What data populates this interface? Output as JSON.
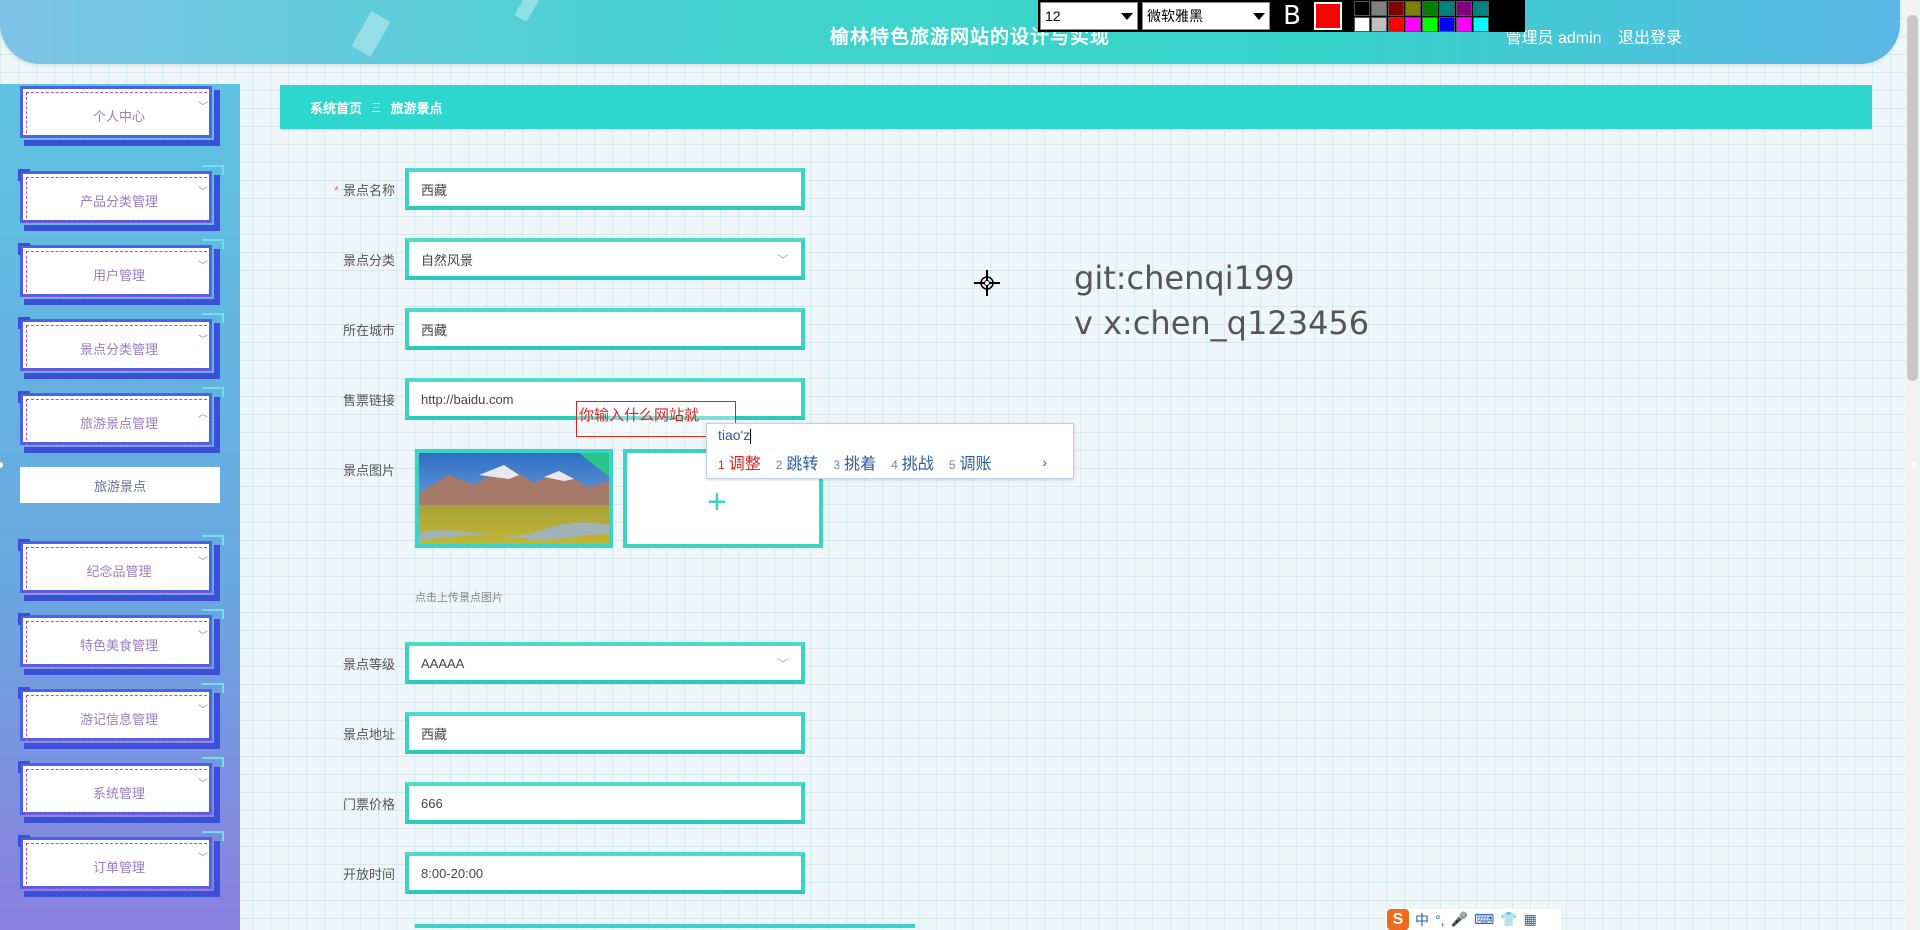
{
  "header": {
    "title": "榆林特色旅游网站的设计与实现",
    "user_label": "管理员 admin",
    "logout": "退出登录"
  },
  "editor_toolbar": {
    "font_size": "12",
    "font_family": "微软雅黑",
    "bold_label": "B",
    "current_color": "#ff0000",
    "palette": [
      "#000000",
      "#808080",
      "#800000",
      "#808000",
      "#008000",
      "#008080",
      "#800080",
      "#008080",
      "#ffffff",
      "#c0c0c0",
      "#ff0000",
      "#ff00ff",
      "#00ff00",
      "#0000ff",
      "#ff00ff",
      "#00ffff"
    ]
  },
  "sidebar": {
    "items": [
      {
        "label": "个人中心"
      },
      {
        "label": "产品分类管理"
      },
      {
        "label": "用户管理"
      },
      {
        "label": "景点分类管理"
      },
      {
        "label": "旅游景点管理"
      },
      {
        "label": "纪念品管理"
      },
      {
        "label": "特色美食管理"
      },
      {
        "label": "游记信息管理"
      },
      {
        "label": "系统管理"
      },
      {
        "label": "订单管理"
      }
    ],
    "active_sub": "旅游景点"
  },
  "breadcrumb": {
    "home": "系统首页",
    "separator": "Ξ",
    "current": "旅游景点"
  },
  "form": {
    "fields": [
      {
        "label": "景点名称",
        "value": "西藏",
        "required": true
      },
      {
        "label": "景点分类",
        "value": "自然风景"
      },
      {
        "label": "所在城市",
        "value": "西藏"
      },
      {
        "label": "售票链接",
        "value": "http://baidu.com"
      },
      {
        "label": "景点图片"
      },
      {
        "label": "景点等级",
        "value": "AAAAA"
      },
      {
        "label": "景点地址",
        "value": "西藏"
      },
      {
        "label": "门票价格",
        "value": "666"
      },
      {
        "label": "开放时间",
        "value": "8:00-20:00"
      }
    ],
    "upload_hint": "点击上传景点图片"
  },
  "annotation_text": "你输入什么网站就",
  "ime": {
    "composition": "tiao'z",
    "candidates": [
      {
        "n": "1",
        "text": "调整"
      },
      {
        "n": "2",
        "text": "跳转"
      },
      {
        "n": "3",
        "text": "挑着"
      },
      {
        "n": "4",
        "text": "挑战"
      },
      {
        "n": "5",
        "text": "调账"
      }
    ],
    "next_arrow": "›"
  },
  "watermark": {
    "line1": "git:chenqi199",
    "line2": "v x:chen_q123456"
  },
  "ime_status": {
    "logo": "S",
    "mode": "中",
    "punct": "°,"
  }
}
